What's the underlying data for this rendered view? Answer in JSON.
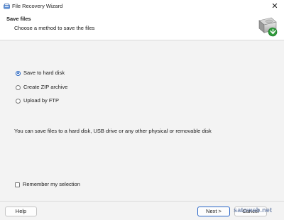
{
  "window": {
    "title": "File Recovery Wizard",
    "close_glyph": "✕",
    "app_icon": "recovery-app-icon"
  },
  "header": {
    "title": "Save files",
    "subtitle": "Choose a method to save the files",
    "icon": "hard-drive-save-icon"
  },
  "options": [
    {
      "label": "Save to hard disk",
      "selected": true
    },
    {
      "label": "Create ZIP archive",
      "selected": false
    },
    {
      "label": "Upload by FTP",
      "selected": false
    }
  ],
  "description": "You can save files to a hard disk, USB drive or any other physical or removable disk",
  "remember": {
    "label": "Remember my selection",
    "checked": false
  },
  "footer": {
    "help_label": "Help",
    "next_label": "Next >",
    "cancel_label": "Cancel"
  },
  "watermark": "satoweb.net",
  "colors": {
    "accent": "#1f5fbf",
    "drive_arrow": "#2e9a3a"
  }
}
